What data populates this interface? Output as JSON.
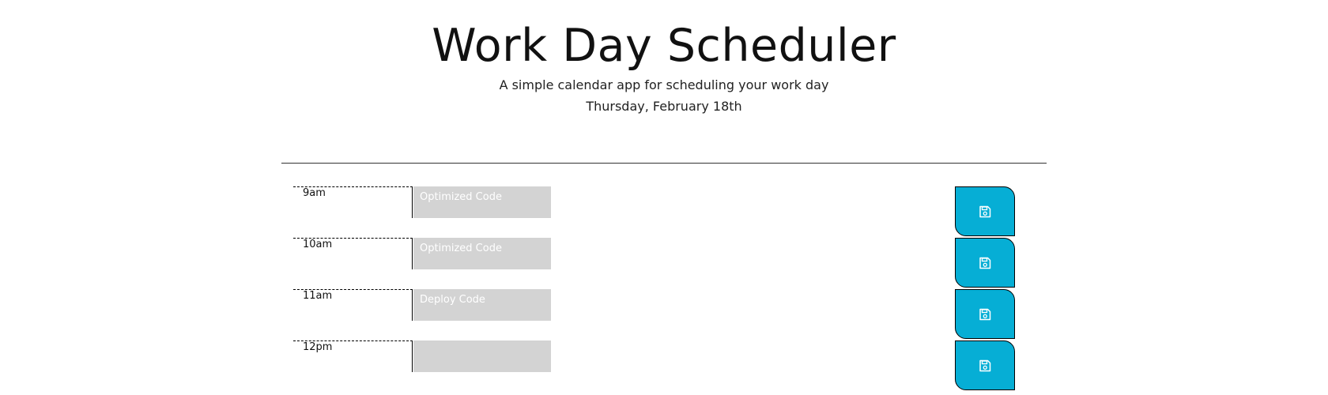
{
  "header": {
    "title": "Work Day Scheduler",
    "lead": "A simple calendar app for scheduling your work day",
    "current_day": "Thursday, February 18th"
  },
  "time_blocks": [
    {
      "hour": "9am",
      "description": "Optimized Code",
      "save_icon": "save-icon"
    },
    {
      "hour": "10am",
      "description": "Optimized Code",
      "save_icon": "save-icon"
    },
    {
      "hour": "11am",
      "description": "Deploy Code",
      "save_icon": "save-icon"
    },
    {
      "hour": "12pm",
      "description": "",
      "save_icon": "save-icon"
    }
  ],
  "colors": {
    "description_bg": "#d3d3d3",
    "save_button": "#06aed5",
    "description_text": "#ffffff"
  }
}
